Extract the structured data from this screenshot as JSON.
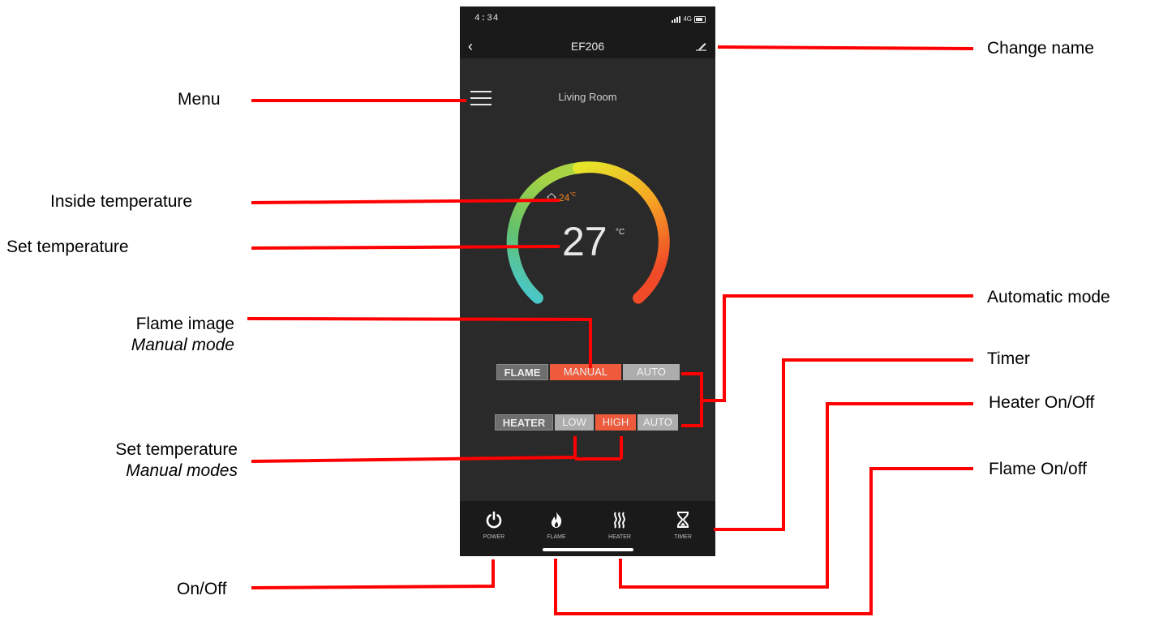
{
  "status": {
    "time": "4:34",
    "network": "4G"
  },
  "nav": {
    "back": "‹",
    "title": "EF206"
  },
  "room": "Living Room",
  "inside_temp": {
    "value": "24",
    "unit": "°C"
  },
  "set_temp": {
    "value": "27",
    "unit": "°C"
  },
  "flame_row": {
    "label": "FLAME",
    "manual": "MANUAL",
    "auto": "AUTO"
  },
  "heater_row": {
    "label": "HEATER",
    "low": "LOW",
    "high": "HIGH",
    "auto": "AUTO"
  },
  "tabs": {
    "power": "POWER",
    "flame": "FLAME",
    "heater": "HEATER",
    "timer": "TIMER"
  },
  "icons": [
    "chevron-left-icon",
    "edit-pencil-icon",
    "hamburger-menu-icon",
    "house-icon",
    "power-icon",
    "flame-icon",
    "heat-waves-icon",
    "hourglass-icon"
  ],
  "annotations": {
    "change_name": "Change name",
    "menu": "Menu",
    "inside_temperature": "Inside temperature",
    "set_temperature": "Set temperature",
    "flame_image": "Flame image",
    "flame_image_sub": "Manual mode",
    "automatic_mode": "Automatic mode",
    "timer": "Timer",
    "heater_onoff": "Heater On/Off",
    "flame_onoff": "Flame On/off",
    "set_temperature_2": "Set temperature",
    "set_temperature_2_sub": "Manual modes",
    "onoff": "On/Off"
  },
  "colors": {
    "accent": "#ee5a3c",
    "inactive": "#adadad",
    "annotation_line": "#ff0000",
    "inside_temp": "#ff8a1f"
  }
}
